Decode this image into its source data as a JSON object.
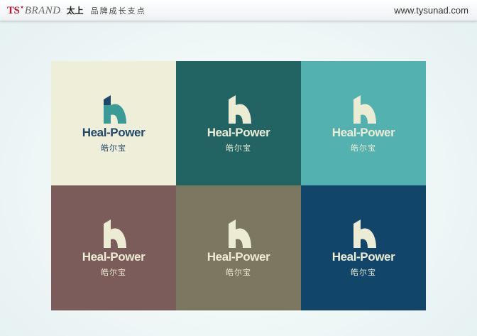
{
  "header": {
    "brand_ts": "TS",
    "brand_star": "★",
    "brand_word": "BRAND",
    "brand_cn": "太上",
    "slogan": "品牌成长支点",
    "url": "www.tysunad.com"
  },
  "logo": {
    "wordmark": "Heal-Power",
    "chinese": "皓尔宝"
  },
  "tiles": [
    {
      "bg": "#efefd9",
      "primary": "#1e4869",
      "accent": "#3a9a95",
      "text": "#1e4869"
    },
    {
      "bg": "#226464",
      "primary": "#ecebd3",
      "accent": "#ecebd3",
      "text": "#ecebd3"
    },
    {
      "bg": "#53b2b0",
      "primary": "#ecebd3",
      "accent": "#ecebd3",
      "text": "#ecebd3"
    },
    {
      "bg": "#7c5b5b",
      "primary": "#ecebd3",
      "accent": "#ecebd3",
      "text": "#ecebd3"
    },
    {
      "bg": "#7b7760",
      "primary": "#ecebd3",
      "accent": "#ecebd3",
      "text": "#ecebd3"
    },
    {
      "bg": "#11466a",
      "primary": "#ecebd3",
      "accent": "#ecebd3",
      "text": "#ecebd3"
    }
  ]
}
